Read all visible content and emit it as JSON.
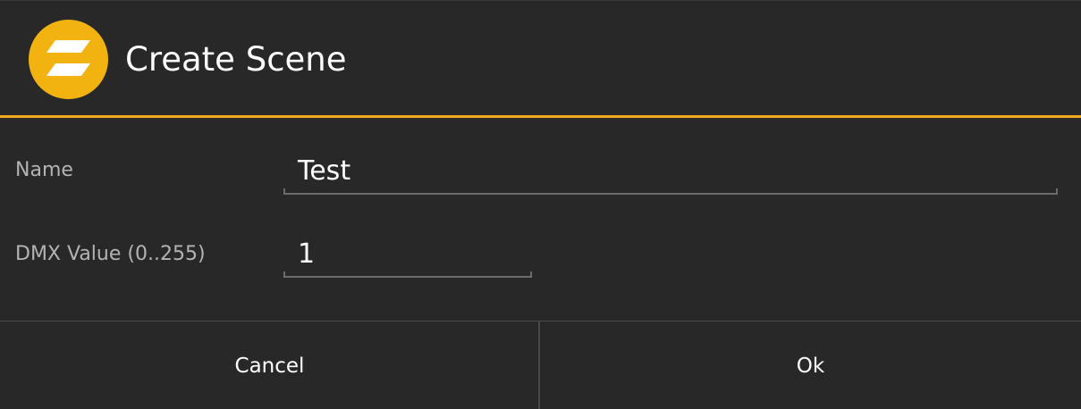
{
  "colors": {
    "accent": "#f5a623",
    "background": "#282828",
    "logo_fill": "#f2b311"
  },
  "dialog": {
    "title": "Create Scene",
    "logo_icon": "app-logo-icon"
  },
  "form": {
    "name_label": "Name",
    "name_value": "Test",
    "dmx_label": "DMX Value (0..255)",
    "dmx_value": "1"
  },
  "buttons": {
    "cancel_label": "Cancel",
    "ok_label": "Ok"
  }
}
